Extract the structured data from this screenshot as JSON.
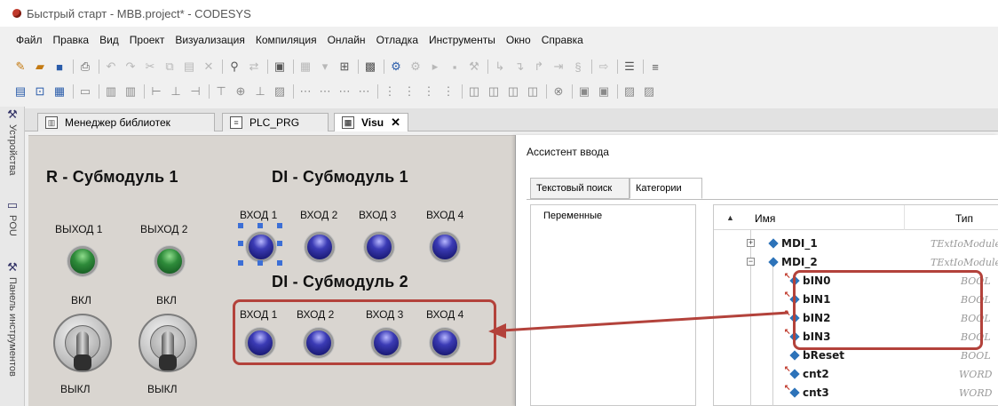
{
  "window": {
    "title": "Быстрый старт - MBB.project* - CODESYS"
  },
  "menu": [
    "Файл",
    "Правка",
    "Вид",
    "Проект",
    "Визуализация",
    "Компиляция",
    "Онлайн",
    "Отладка",
    "Инструменты",
    "Окно",
    "Справка"
  ],
  "dock": {
    "devices": "Устройства",
    "pou": "POU",
    "toolbox": "Панель инструментов"
  },
  "tabs": [
    {
      "label": "Менеджер библиотек",
      "icon": "library-icon"
    },
    {
      "label": "PLC_PRG",
      "icon": "document-icon"
    },
    {
      "label": "Visu",
      "icon": "visu-icon",
      "close": "✕"
    }
  ],
  "visu": {
    "r_heading": "R - Субмодуль 1",
    "di1_heading": "DI - Субмодуль 1",
    "di2_heading": "DI - Субмодуль 2",
    "outputs": [
      "ВЫХОД 1",
      "ВЫХОД 2"
    ],
    "on_label": "ВКЛ",
    "off_label": "ВЫКЛ",
    "di1_inputs": [
      "ВХОД 1",
      "ВХОД 2",
      "ВХОД 3",
      "ВХОД 4"
    ],
    "di2_inputs": [
      "ВХОД 1",
      "ВХОД 2",
      "ВХОД 3",
      "ВХОД 4"
    ],
    "colors": {
      "accent_box": "#b3423b",
      "led_green": "#2e8b3a",
      "led_blue": "#1d1d8a"
    }
  },
  "assistant": {
    "title": "Ассистент ввода",
    "tabs": [
      "Текстовый поиск",
      "Категории"
    ],
    "active_tab": "Категории",
    "categories": [
      "Переменные"
    ],
    "columns": {
      "name": "Имя",
      "type": "Тип"
    },
    "rows": [
      {
        "name": "MDI_1",
        "type": "TExtIoModuleSyn",
        "expander": "+"
      },
      {
        "name": "MDI_2",
        "type": "TExtIoModuleSyn",
        "expander": "−"
      },
      {
        "name": "bIN0",
        "type": "BOOL"
      },
      {
        "name": "bIN1",
        "type": "BOOL"
      },
      {
        "name": "bIN2",
        "type": "BOOL"
      },
      {
        "name": "bIN3",
        "type": "BOOL"
      },
      {
        "name": "bReset",
        "type": "BOOL"
      },
      {
        "name": "cnt2",
        "type": "WORD"
      },
      {
        "name": "cnt3",
        "type": "WORD"
      }
    ]
  }
}
